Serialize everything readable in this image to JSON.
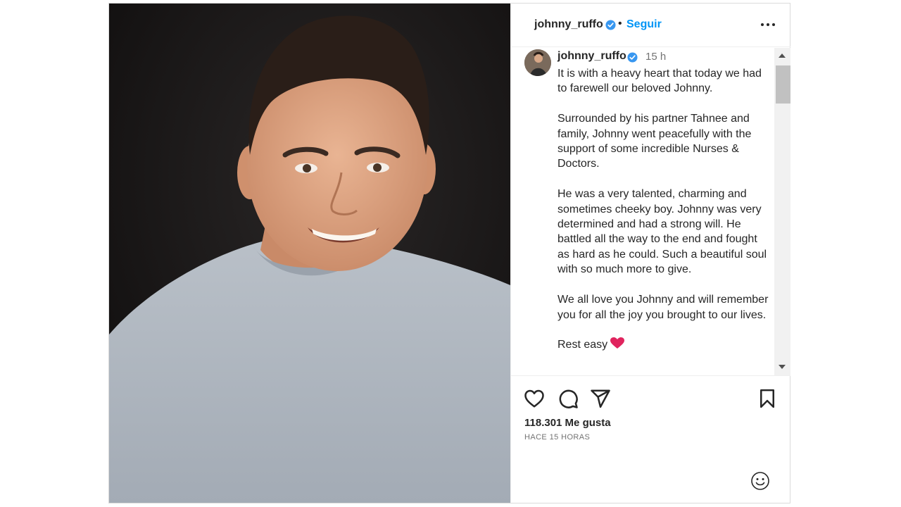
{
  "header": {
    "username": "johnny_ruffo",
    "separator": "•",
    "follow_label": "Seguir"
  },
  "caption": {
    "username": "johnny_ruffo",
    "time": "15 h",
    "text": "It is with a heavy heart that today we had to farewell our beloved Johnny.\n\nSurrounded by his partner Tahnee and family, Johnny went peacefully with the support of some incredible Nurses & Doctors.\n\nHe was a very talented, charming and sometimes cheeky boy. Johnny was very determined and had a strong will. He battled all the way to the end and fought as hard as he could. Such a beautiful soul with so much more to give.\n\nWe all love you Johnny and will remember you for all the joy you brought to our lives.\n\nRest easy",
    "emoji": "red-heart-emoji"
  },
  "stats": {
    "likes": "118.301 Me gusta",
    "time_ago": "HACE 15 HORAS"
  },
  "icons": {
    "verified": "verified-badge-icon",
    "more": "more-options-icon",
    "like": "heart-outline-icon",
    "comment": "comment-bubble-icon",
    "share": "paper-plane-icon",
    "save": "bookmark-icon",
    "emoji": "smiley-face-icon"
  },
  "colors": {
    "accent": "#0095f6",
    "text": "#262626",
    "muted": "#737373",
    "verified": "#3897f0",
    "heart": "#e0245e"
  }
}
